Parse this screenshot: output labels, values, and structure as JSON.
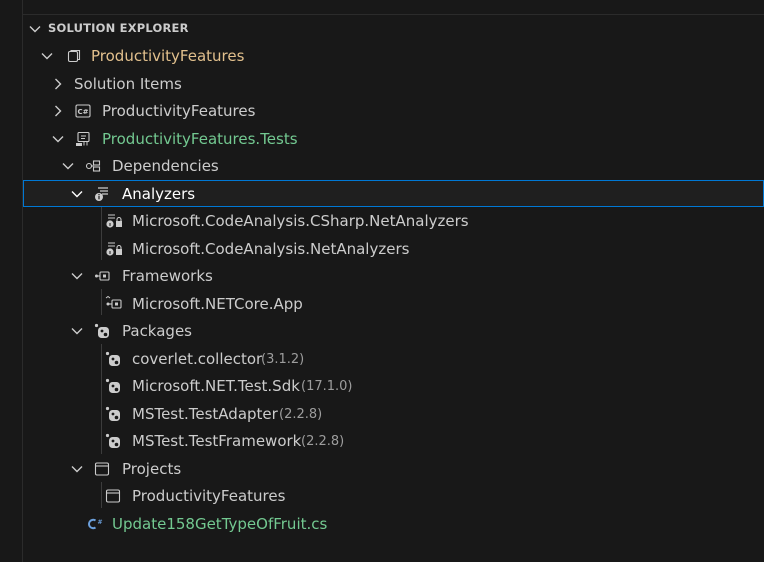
{
  "explorer": {
    "title": "SOLUTION EXPLORER"
  },
  "tree": {
    "root": {
      "label": "ProductivityFeatures"
    },
    "solution_items": {
      "label": "Solution Items"
    },
    "project_main": {
      "label": "ProductivityFeatures"
    },
    "project_tests": {
      "label": "ProductivityFeatures.Tests"
    },
    "dependencies": {
      "label": "Dependencies"
    },
    "analyzers": {
      "label": "Analyzers",
      "items": [
        {
          "label": "Microsoft.CodeAnalysis.CSharp.NetAnalyzers"
        },
        {
          "label": "Microsoft.CodeAnalysis.NetAnalyzers"
        }
      ]
    },
    "frameworks": {
      "label": "Frameworks",
      "items": [
        {
          "label": "Microsoft.NETCore.App"
        }
      ]
    },
    "packages": {
      "label": "Packages",
      "items": [
        {
          "label": "coverlet.collector",
          "version": "(3.1.2)"
        },
        {
          "label": "Microsoft.NET.Test.Sdk",
          "version": "(17.1.0)"
        },
        {
          "label": "MSTest.TestAdapter",
          "version": "(2.2.8)"
        },
        {
          "label": "MSTest.TestFramework",
          "version": "(2.2.8)"
        }
      ]
    },
    "projects": {
      "label": "Projects",
      "items": [
        {
          "label": "ProductivityFeatures"
        }
      ]
    },
    "file": {
      "label": "Update158GetTypeOfFruit.cs"
    }
  },
  "colors": {
    "root_label": "#e2c08d",
    "tests_label": "#73c991",
    "file_label": "#73c991",
    "selection_border": "#0078d4",
    "version_text": "#9d9d9d"
  }
}
